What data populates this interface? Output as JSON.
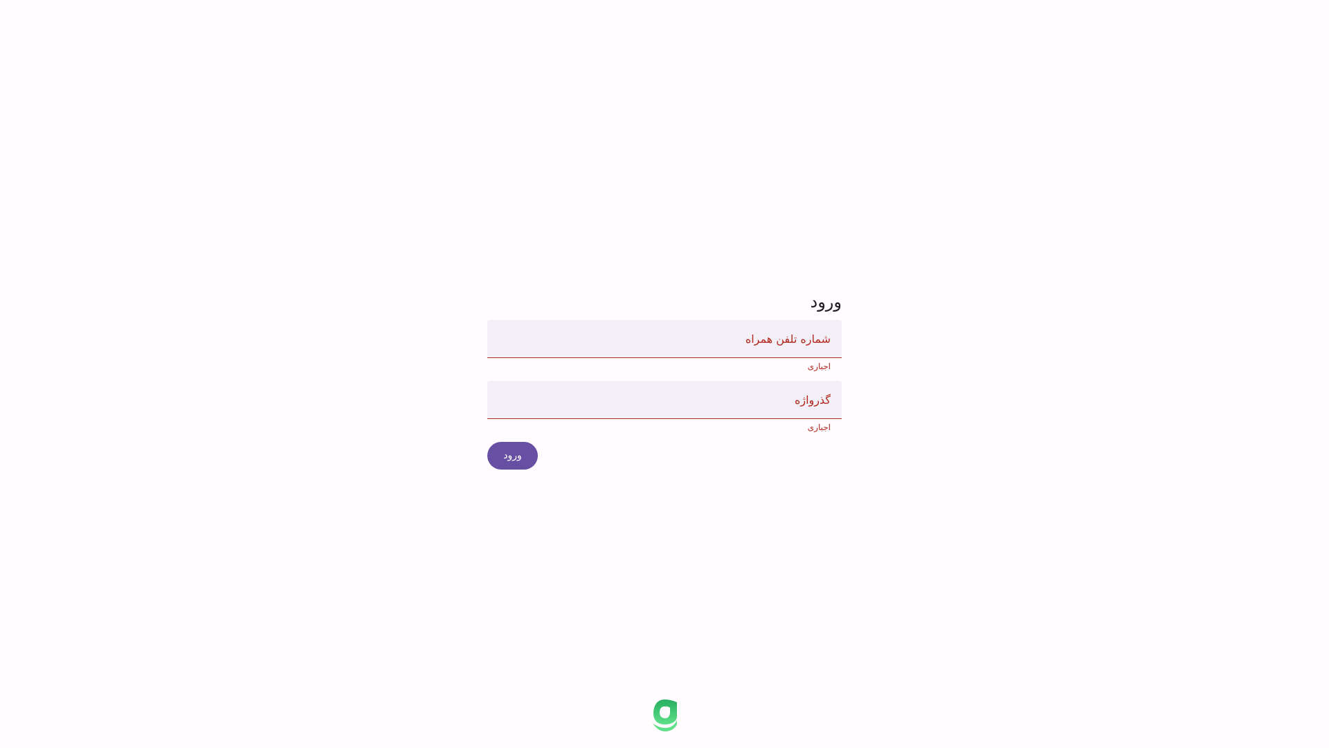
{
  "form": {
    "title": "ورود",
    "phone": {
      "placeholder": "شماره تلفن همراه",
      "value": "",
      "helper": "اجباری"
    },
    "password": {
      "placeholder": "گذرواژه",
      "value": "",
      "helper": "اجباری"
    },
    "submit_label": "ورود"
  },
  "footer": {
    "logo_icon": "brand-logo-icon"
  },
  "colors": {
    "background": "#fffbfe",
    "field_fill": "#f3eff7",
    "error": "#b3261e",
    "primary": "#6750a4",
    "logo_green": "#2ecc71"
  }
}
